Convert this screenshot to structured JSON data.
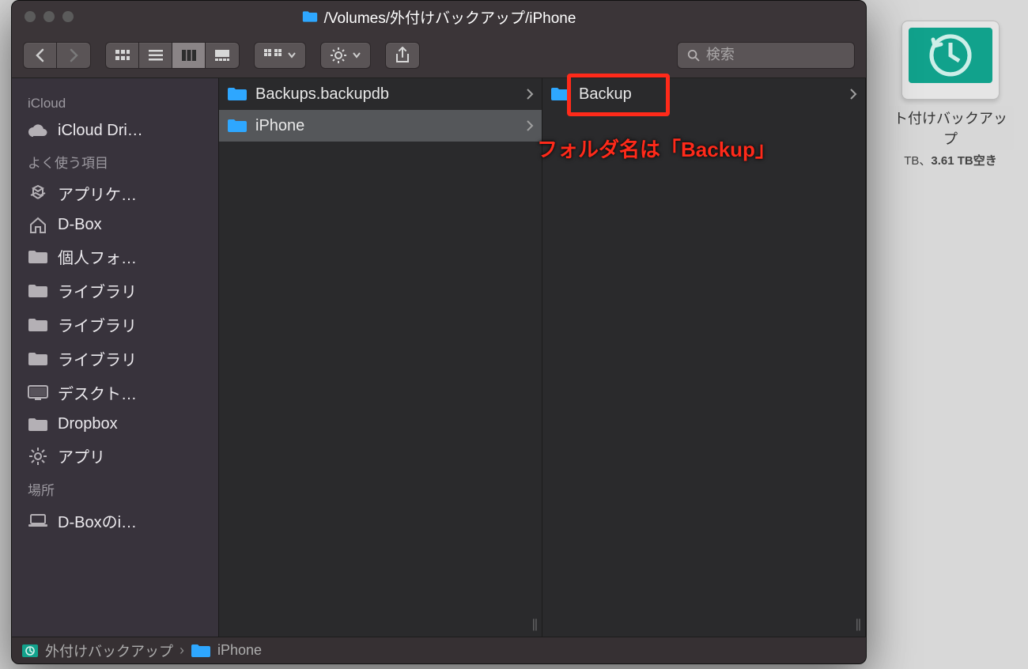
{
  "window": {
    "title": "/Volumes/外付けバックアップ/iPhone"
  },
  "search": {
    "placeholder": "検索"
  },
  "sidebar": {
    "sections": [
      {
        "header": "iCloud",
        "items": [
          {
            "label": "iCloud Dri…",
            "icon": "cloud-icon"
          }
        ]
      },
      {
        "header": "よく使う項目",
        "items": [
          {
            "label": "アプリケ…",
            "icon": "apps-icon"
          },
          {
            "label": "D-Box",
            "icon": "home-icon"
          },
          {
            "label": "個人フォ…",
            "icon": "folder-icon"
          },
          {
            "label": "ライブラリ",
            "icon": "folder-icon"
          },
          {
            "label": "ライブラリ",
            "icon": "folder-icon"
          },
          {
            "label": "ライブラリ",
            "icon": "folder-icon"
          },
          {
            "label": "デスクト…",
            "icon": "desktop-icon"
          },
          {
            "label": "Dropbox",
            "icon": "folder-icon"
          },
          {
            "label": "アプリ",
            "icon": "gear-icon"
          }
        ]
      },
      {
        "header": "場所",
        "items": [
          {
            "label": "D-Boxのi…",
            "icon": "laptop-icon"
          }
        ]
      }
    ]
  },
  "columns": [
    {
      "rows": [
        {
          "label": "Backups.backupdb",
          "selected": false,
          "hasChildren": true
        },
        {
          "label": "iPhone",
          "selected": true,
          "hasChildren": true
        }
      ]
    },
    {
      "rows": [
        {
          "label": "Backup",
          "selected": false,
          "hasChildren": true
        }
      ]
    }
  ],
  "annotation": {
    "box_target": "Backup",
    "text": "フォルダ名は「Backup」"
  },
  "pathbar": {
    "segments": [
      {
        "label": "外付けバックアップ",
        "icon": "tm-drive-icon"
      },
      {
        "label": "iPhone",
        "icon": "folder-icon"
      }
    ]
  },
  "desktop_drive": {
    "name": "外付けバックアップ",
    "name_clipped": "ト付けバックアップ",
    "info": "TB、3.61 TB空き",
    "info_prefix": "TB、",
    "info_free": "3.61 TB空き"
  }
}
